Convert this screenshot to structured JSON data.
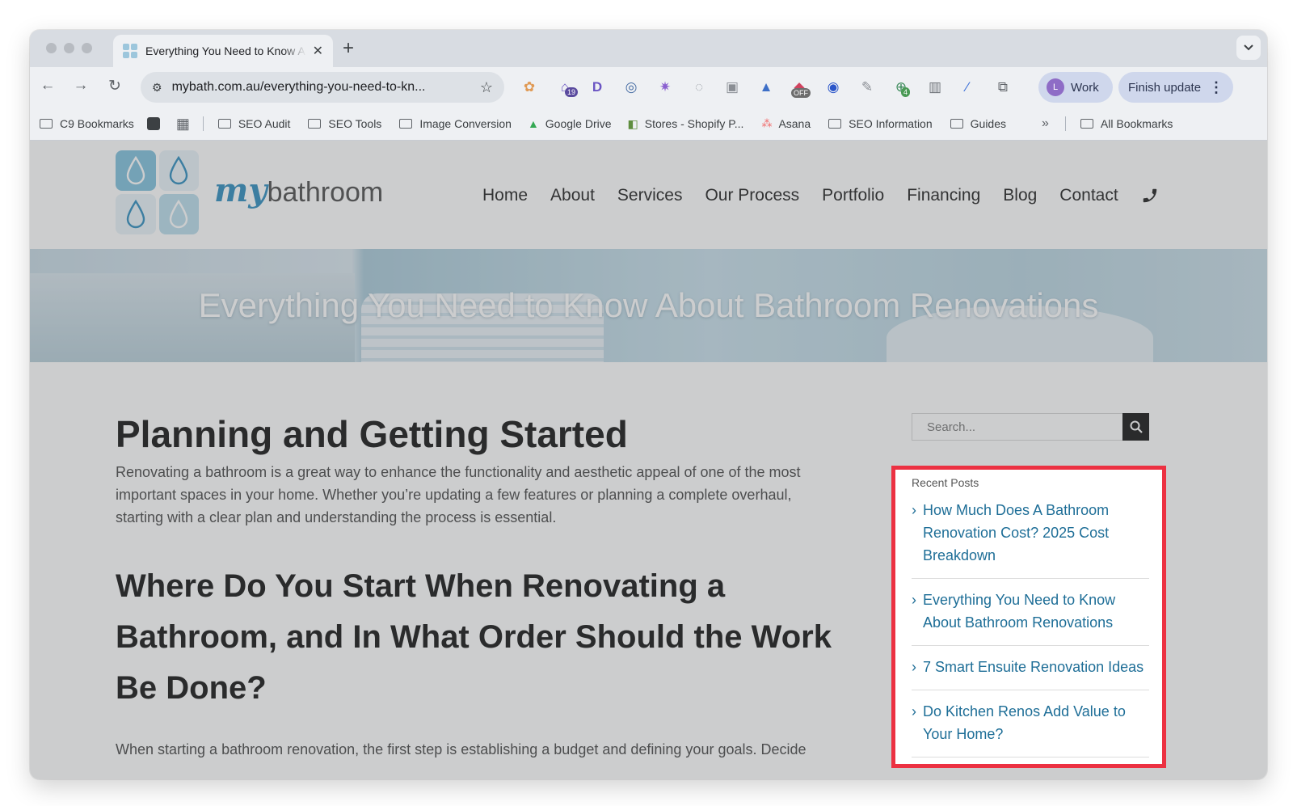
{
  "browser": {
    "tab_title": "Everything You Need to Know About Bathroom Renovations",
    "new_tab_label": "+",
    "tab_close": "✕",
    "url": "mybath.com.au/everything-you-need-to-kn...",
    "profile_initial": "L",
    "profile_name": "Work",
    "update_label": "Finish update",
    "extension_badges": [
      "19",
      "OFF",
      "4"
    ],
    "bookmarks": [
      {
        "label": "C9 Bookmarks",
        "icon": "folder-icon"
      },
      {
        "label": "SEO Audit",
        "icon": "folder-icon"
      },
      {
        "label": "SEO Tools",
        "icon": "folder-icon"
      },
      {
        "label": "Image Conversion",
        "icon": "folder-icon"
      },
      {
        "label": "Google Drive",
        "icon": "google-drive-icon"
      },
      {
        "label": "Stores - Shopify P...",
        "icon": "shopify-icon"
      },
      {
        "label": "Asana",
        "icon": "asana-icon"
      },
      {
        "label": "SEO Information",
        "icon": "folder-icon"
      },
      {
        "label": "Guides",
        "icon": "folder-icon"
      }
    ],
    "bookmarks_overflow": "»",
    "all_bookmarks": "All Bookmarks"
  },
  "site": {
    "logo_my": "my",
    "logo_word": "bathroom",
    "nav": [
      "Home",
      "About",
      "Services",
      "Our Process",
      "Portfolio",
      "Financing",
      "Blog",
      "Contact"
    ],
    "hero_title": "Everything You Need to Know About Bathroom Renovations",
    "colors": {
      "brand_blue": "#2b8bbd",
      "link": "#1e6e97",
      "highlight": "#ec3142"
    }
  },
  "article": {
    "h1": "Planning and Getting Started",
    "intro": "Renovating a bathroom is a great way to enhance the functionality and aesthetic appeal of one of the most important spaces in your home. Whether you’re updating a few features or planning a complete overhaul, starting with a clear plan and understanding the process is essential.",
    "h2": "Where Do You Start When Renovating a Bathroom, and In What Order Should the Work Be Done?",
    "p2": "When starting a bathroom renovation, the first step is establishing a budget and defining your goals. Decide"
  },
  "sidebar": {
    "search_placeholder": "Search...",
    "recent_title": "Recent Posts",
    "posts": [
      "How Much Does A Bathroom Renovation Cost? 2025 Cost Breakdown",
      "Everything You Need to Know About Bathroom Renovations",
      "7 Smart Ensuite Renovation Ideas",
      "Do Kitchen Renos Add Value to Your Home?"
    ]
  }
}
